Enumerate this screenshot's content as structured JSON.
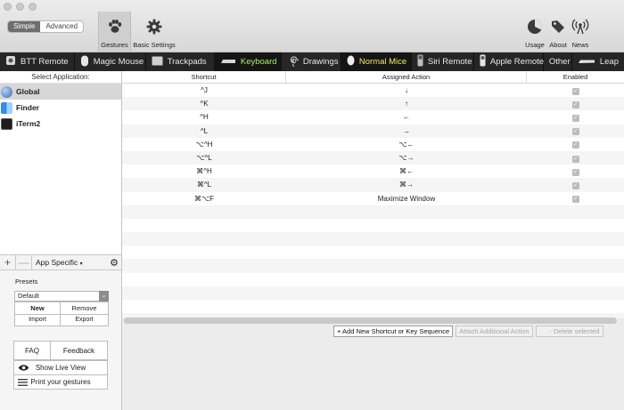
{
  "mode_toggle": {
    "simple": "Simple",
    "advanced": "Advanced"
  },
  "toolbar": {
    "gestures": "Gestures",
    "basic_settings": "Basic Settings",
    "usage": "Usage",
    "about": "About",
    "news": "News"
  },
  "categories": [
    {
      "label": "BTT Remote",
      "icon": "remote-icon"
    },
    {
      "label": "Magic Mouse",
      "icon": "magic-mouse-icon"
    },
    {
      "label": "Trackpads",
      "icon": "trackpad-icon"
    },
    {
      "label": "Keyboard",
      "icon": "keyboard-icon",
      "state": "active"
    },
    {
      "label": "Drawings",
      "icon": "drawing-icon"
    },
    {
      "label": "Normal Mice",
      "icon": "mouse-icon",
      "state": "highlighted"
    },
    {
      "label": "Siri Remote",
      "icon": "siri-remote-icon"
    },
    {
      "label": "Apple Remote",
      "icon": "apple-remote-icon"
    },
    {
      "label": "Other",
      "icon": ""
    },
    {
      "label": "Leap",
      "icon": "leap-icon"
    }
  ],
  "sidebar": {
    "header": "Select Application:",
    "apps": [
      {
        "name": "Global",
        "icon": "globe-icon",
        "selected": true
      },
      {
        "name": "Finder",
        "icon": "finder-icon"
      },
      {
        "name": "iTerm2",
        "icon": "terminal-icon"
      }
    ],
    "add": "+",
    "remove": "—",
    "filter": "App Specific",
    "presets_label": "Presets",
    "preset_value": "Default",
    "new": "New",
    "remove_preset": "Remove",
    "import": "Import",
    "export": "Export",
    "faq": "FAQ",
    "feedback": "Feedback",
    "live_view": "Show Live View",
    "print": "Print your gestures"
  },
  "table": {
    "columns": [
      "Shortcut",
      "Assigned Action",
      "Enabled"
    ],
    "rows": [
      {
        "shortcut": "^J",
        "action": "↓",
        "enabled": true
      },
      {
        "shortcut": "^K",
        "action": "↑",
        "enabled": true
      },
      {
        "shortcut": "^H",
        "action": "←",
        "enabled": true
      },
      {
        "shortcut": "^L",
        "action": "→",
        "enabled": true
      },
      {
        "shortcut": "⌥^H",
        "action": "⌥←",
        "enabled": true
      },
      {
        "shortcut": "⌥^L",
        "action": "⌥→",
        "enabled": true
      },
      {
        "shortcut": "⌘^H",
        "action": "⌘←",
        "enabled": true
      },
      {
        "shortcut": "⌘^L",
        "action": "⌘→",
        "enabled": true
      },
      {
        "shortcut": "⌘⌥F",
        "action": "Maximize Window",
        "enabled": true
      }
    ]
  },
  "actions": {
    "add": "+ Add New Shortcut or Key Sequence",
    "attach": "Attach Additional Action",
    "delete": "- Delete selected"
  },
  "colors": {
    "active_category": "#a9ec66",
    "highlight_category": "#f6ea6a",
    "category_bar": "#262626"
  }
}
